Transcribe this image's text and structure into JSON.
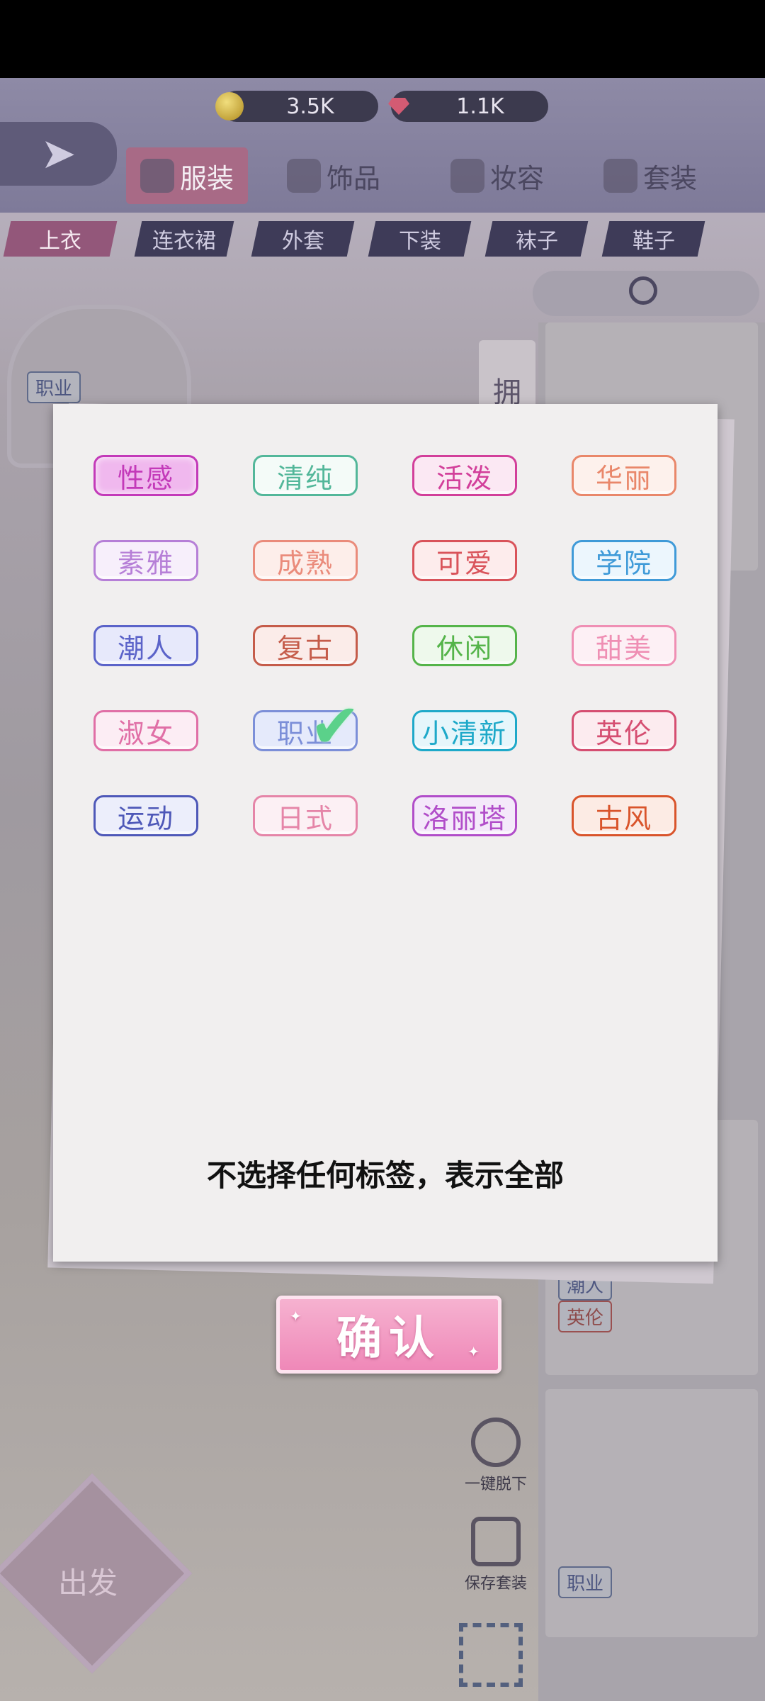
{
  "resources": {
    "coins": "3.5K",
    "gems": "1.1K"
  },
  "categories": [
    {
      "label": "服装",
      "icon": "dress-icon",
      "active": true
    },
    {
      "label": "饰品",
      "icon": "stars-icon"
    },
    {
      "label": "妆容",
      "icon": "makeup-icon"
    },
    {
      "label": "套装",
      "icon": "crown-icon"
    }
  ],
  "subcategories": [
    "上衣",
    "连衣裙",
    "外套",
    "下装",
    "袜子",
    "鞋子"
  ],
  "scene": {
    "left_panel_tag": "职业",
    "side_tab": "拥",
    "card_tags": [
      "潮人",
      "英伦",
      "职业"
    ],
    "tools": {
      "undress": "一键脱下",
      "save": "保存套装"
    },
    "depart": "出发"
  },
  "filter_dialog": {
    "tags": [
      {
        "label": "性感",
        "color": "#c33ab9",
        "bg": "#f0b8ee",
        "selected": true
      },
      {
        "label": "清纯",
        "color": "#53b79a",
        "bg": "#f4fbf8"
      },
      {
        "label": "活泼",
        "color": "#d23f9a",
        "bg": "#fbe8f3"
      },
      {
        "label": "华丽",
        "color": "#e9876a",
        "bg": "#fdf1ec"
      },
      {
        "label": "素雅",
        "color": "#b67fd7",
        "bg": "#f7effb"
      },
      {
        "label": "成熟",
        "color": "#ea8b7b",
        "bg": "#fdeeea"
      },
      {
        "label": "可爱",
        "color": "#d9535a",
        "bg": "#fdecec"
      },
      {
        "label": "学院",
        "color": "#3f9ad8",
        "bg": "#ecf6fd"
      },
      {
        "label": "潮人",
        "color": "#5b63c9",
        "bg": "#e7e9fb"
      },
      {
        "label": "复古",
        "color": "#c55c4a",
        "bg": "#fbece9"
      },
      {
        "label": "休闲",
        "color": "#55b44a",
        "bg": "#eef9ec"
      },
      {
        "label": "甜美",
        "color": "#ef8fb4",
        "bg": "#fdf0f5"
      },
      {
        "label": "淑女",
        "color": "#e06fa6",
        "bg": "#fcedf4"
      },
      {
        "label": "职业",
        "color": "#7c8fd8",
        "bg": "#e5eafb",
        "checked": true
      },
      {
        "label": "小清新",
        "color": "#1ea9c9",
        "bg": "#e6f6fb"
      },
      {
        "label": "英伦",
        "color": "#d54e71",
        "bg": "#fcebef"
      },
      {
        "label": "运动",
        "color": "#4e58b8",
        "bg": "#eceefb"
      },
      {
        "label": "日式",
        "color": "#e585a8",
        "bg": "#fcf0f4"
      },
      {
        "label": "洛丽塔",
        "color": "#b14dc9",
        "bg": "#f4e9fa"
      },
      {
        "label": "古风",
        "color": "#d9542b",
        "bg": "#fcebe4"
      }
    ],
    "hint": "不选择任何标签，表示全部",
    "confirm_label": "确认"
  }
}
